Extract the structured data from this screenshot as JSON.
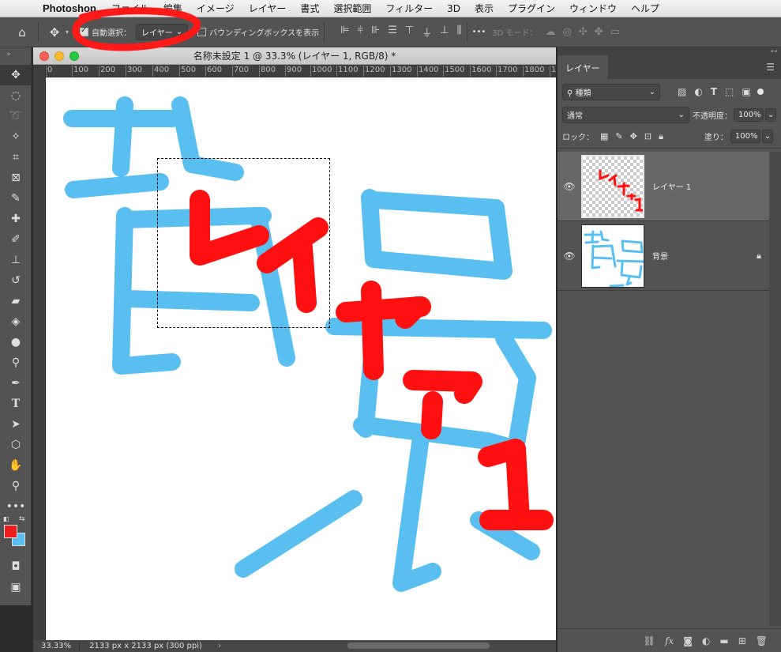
{
  "menubar": {
    "app": "Photoshop",
    "items": [
      "ファイル",
      "編集",
      "イメージ",
      "レイヤー",
      "書式",
      "選択範囲",
      "フィルター",
      "3D",
      "表示",
      "プラグイン",
      "ウィンドウ",
      "ヘルプ"
    ]
  },
  "options": {
    "auto_select_label": "自動選択：",
    "auto_select_target": "レイヤー",
    "bounding_box_label": "バウンディングボックスを表示",
    "more": "•••",
    "mode_3d": "3D モード："
  },
  "document": {
    "title": "名称未設定 1 @ 33.3% (レイヤー 1, RGB/8) *",
    "ruler_ticks": [
      "0",
      "100",
      "200",
      "300",
      "400",
      "500",
      "600",
      "700",
      "800",
      "900",
      "1000",
      "1100",
      "1200",
      "1300",
      "1400",
      "1500",
      "1600",
      "1700",
      "1800",
      "1"
    ],
    "status_zoom": "33.33%",
    "status_info": "2133 px x 2133 px (300 ppi)",
    "status_arrow": "›"
  },
  "colors": {
    "foreground": "#ee1c1c",
    "background": "#58bff0",
    "annotation": "#ff1a1a"
  },
  "layers_panel": {
    "tab": "レイヤー",
    "filter_kind": "種類",
    "blend_mode": "通常",
    "opacity_label": "不透明度：",
    "opacity_value": "100%",
    "lock_label": "ロック：",
    "fill_label": "塗り：",
    "fill_value": "100%",
    "layers": [
      {
        "name": "レイヤー 1",
        "selected": true,
        "locked": false
      },
      {
        "name": "背景",
        "selected": false,
        "locked": true
      }
    ]
  }
}
